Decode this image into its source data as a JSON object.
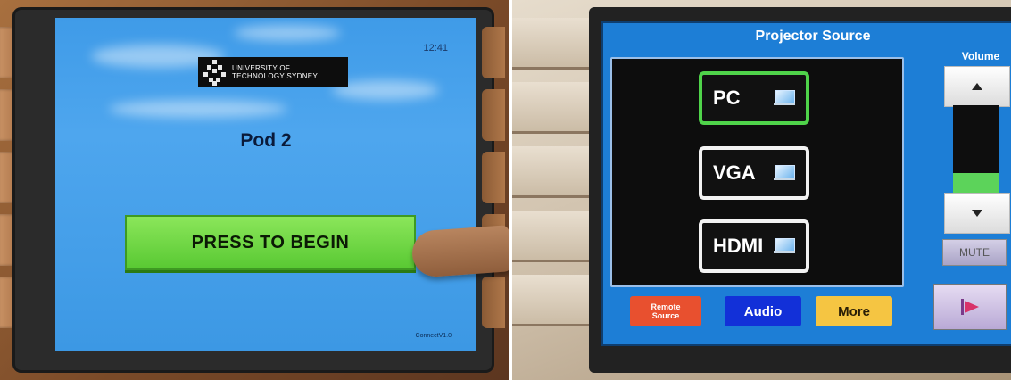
{
  "left_panel": {
    "clock": "12:41",
    "logo_line1": "UNIVERSITY OF",
    "logo_line2": "TECHNOLOGY SYDNEY",
    "pod_title": "Pod 2",
    "begin_button": "PRESS TO BEGIN",
    "version": "ConnectV1.0"
  },
  "right_panel": {
    "title": "Projector Source",
    "sources": [
      {
        "label": "PC",
        "selected": true,
        "icon": "monitor-icon"
      },
      {
        "label": "VGA",
        "selected": false,
        "icon": "monitor-icon"
      },
      {
        "label": "HDMI",
        "selected": false,
        "icon": "monitor-icon"
      }
    ],
    "volume": {
      "label": "Volume",
      "level_fraction": 0.22,
      "up_icon": "triangle-up-icon",
      "down_icon": "triangle-down-icon"
    },
    "mute_label": "MUTE",
    "power_icon": "projector-power-icon",
    "bottom_buttons": {
      "remote_line1": "Remote",
      "remote_line2": "Source",
      "audio": "Audio",
      "more": "More"
    }
  },
  "colors": {
    "screen_blue": "#3f9be8",
    "begin_green": "#59c933",
    "selected_border": "#4fd34a",
    "remote_red": "#e8502f",
    "audio_blue": "#1230d8",
    "more_yellow": "#f5c542"
  }
}
